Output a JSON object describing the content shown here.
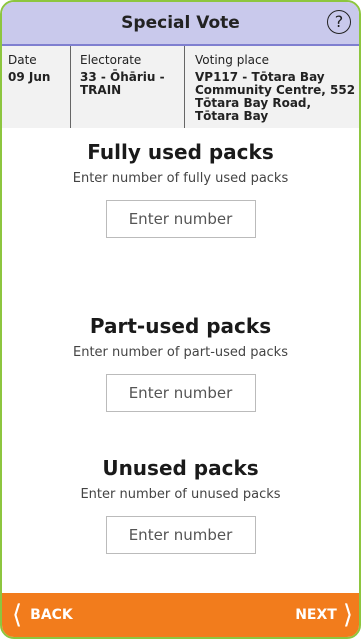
{
  "header": {
    "title": "Special Vote",
    "help_icon": "?"
  },
  "info": {
    "date_label": "Date",
    "date_value": "09 Jun",
    "electorate_label": "Electorate",
    "electorate_value": "33 - Ōhāriu - TRAIN",
    "place_label": "Voting place",
    "place_value": "VP117 - Tōtara Bay Community Centre, 552 Tōtara Bay Road, Tōtara Bay"
  },
  "sections": [
    {
      "title": "Fully used packs",
      "subtitle": "Enter number of fully used packs",
      "placeholder": "Enter number"
    },
    {
      "title": "Part-used packs",
      "subtitle": "Enter number of part-used packs",
      "placeholder": "Enter number"
    },
    {
      "title": "Unused packs",
      "subtitle": "Enter number of unused packs",
      "placeholder": "Enter number"
    }
  ],
  "footer": {
    "back_label": "BACK",
    "next_label": "NEXT",
    "back_icon": "chevron-left-icon",
    "next_icon": "chevron-right-icon"
  },
  "colors": {
    "frame_border": "#8dc63f",
    "header_bg": "#c9c9ec",
    "header_border": "#7f7fd0",
    "info_bg": "#f2f2f2",
    "footer_bg": "#f27c1c"
  }
}
